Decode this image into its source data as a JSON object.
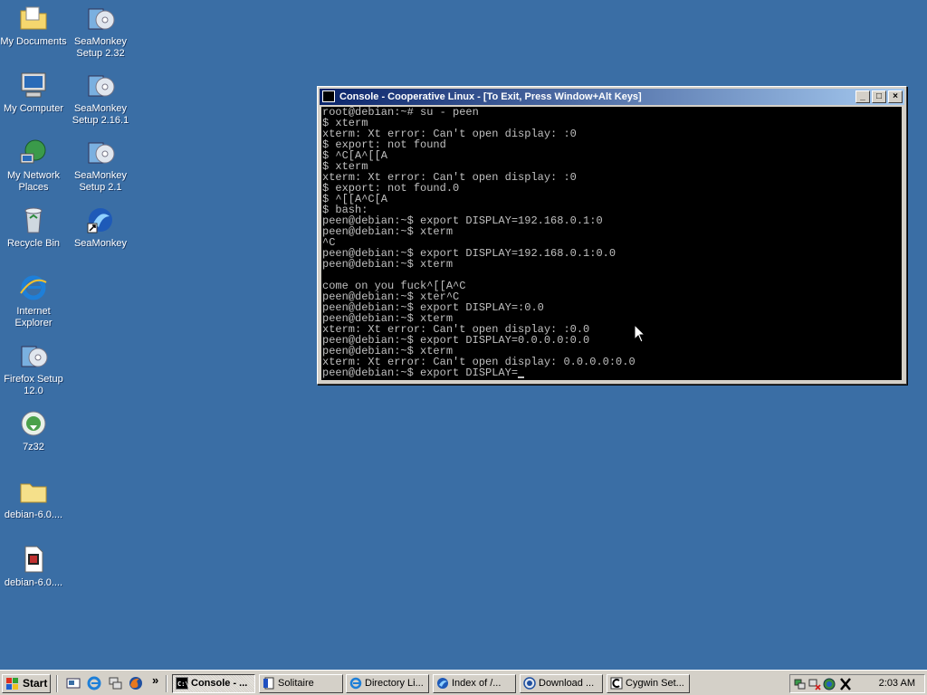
{
  "desktop": {
    "icons": [
      {
        "label": "My Documents"
      },
      {
        "label": "My Computer"
      },
      {
        "label": "My Network Places"
      },
      {
        "label": "Recycle Bin"
      },
      {
        "label": "Internet Explorer"
      },
      {
        "label": "Firefox Setup 12.0"
      },
      {
        "label": "7z32"
      },
      {
        "label": "debian-6.0...."
      },
      {
        "label": "debian-6.0...."
      },
      {
        "label": "SeaMonkey Setup 2.32"
      },
      {
        "label": "SeaMonkey Setup 2.16.1"
      },
      {
        "label": "SeaMonkey Setup 2.1"
      },
      {
        "label": "SeaMonkey"
      }
    ]
  },
  "console": {
    "title": "Console - Cooperative Linux - [To Exit, Press Window+Alt Keys]",
    "lines": [
      "root@debian:~# su - peen",
      "$ xterm",
      "xterm: Xt error: Can't open display: :0",
      "$ export: not found",
      "$ ^C[A^[[A",
      "$ xterm",
      "xterm: Xt error: Can't open display: :0",
      "$ export: not found.0",
      "$ ^[[A^C[A",
      "$ bash:",
      "peen@debian:~$ export DISPLAY=192.168.0.1:0",
      "peen@debian:~$ xterm",
      "^C",
      "peen@debian:~$ export DISPLAY=192.168.0.1:0.0",
      "peen@debian:~$ xterm",
      "",
      "come on you fuck^[[A^C",
      "peen@debian:~$ xter^C",
      "peen@debian:~$ export DISPLAY=:0.0",
      "peen@debian:~$ xterm",
      "xterm: Xt error: Can't open display: :0.0",
      "peen@debian:~$ export DISPLAY=0.0.0.0:0.0",
      "peen@debian:~$ xterm",
      "xterm: Xt error: Can't open display: 0.0.0.0:0.0",
      "peen@debian:~$ export DISPLAY="
    ]
  },
  "taskbar": {
    "start_label": "Start",
    "buttons": [
      {
        "label": "Console - ..."
      },
      {
        "label": "Solitaire"
      },
      {
        "label": "Directory Li..."
      },
      {
        "label": "Index of /..."
      },
      {
        "label": "Download ..."
      },
      {
        "label": "Cygwin Set..."
      }
    ],
    "clock": "2:03 AM",
    "quicklaunch_more": "»"
  }
}
